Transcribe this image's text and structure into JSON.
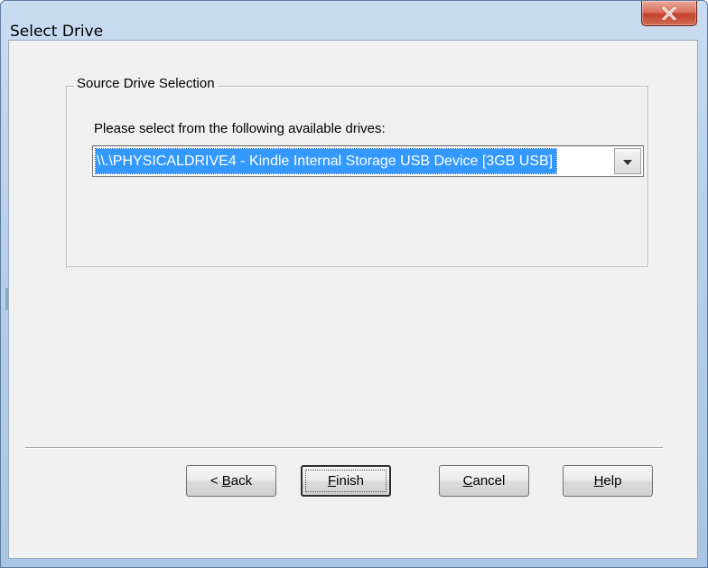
{
  "window": {
    "title": "Select Drive",
    "close_icon": "close-x-icon"
  },
  "group": {
    "legend": "Source Drive Selection",
    "prompt": "Please select from the following available drives:"
  },
  "drive_select": {
    "selected_value": "\\\\.\\PHYSICALDRIVE4 - Kindle Internal Storage USB Device [3GB USB]",
    "arrow_icon": "chevron-down-icon"
  },
  "buttons": {
    "back": {
      "prefix": "< ",
      "accel": "B",
      "rest": "ack"
    },
    "finish": {
      "prefix": "",
      "accel": "F",
      "rest": "inish"
    },
    "cancel": {
      "prefix": "",
      "accel": "C",
      "rest": "ancel"
    },
    "help": {
      "prefix": "",
      "accel": "H",
      "rest": "elp"
    }
  },
  "colors": {
    "selection": "#3399ff",
    "dialog_bg": "#f0f0f0",
    "close_button": "#c4442c"
  }
}
